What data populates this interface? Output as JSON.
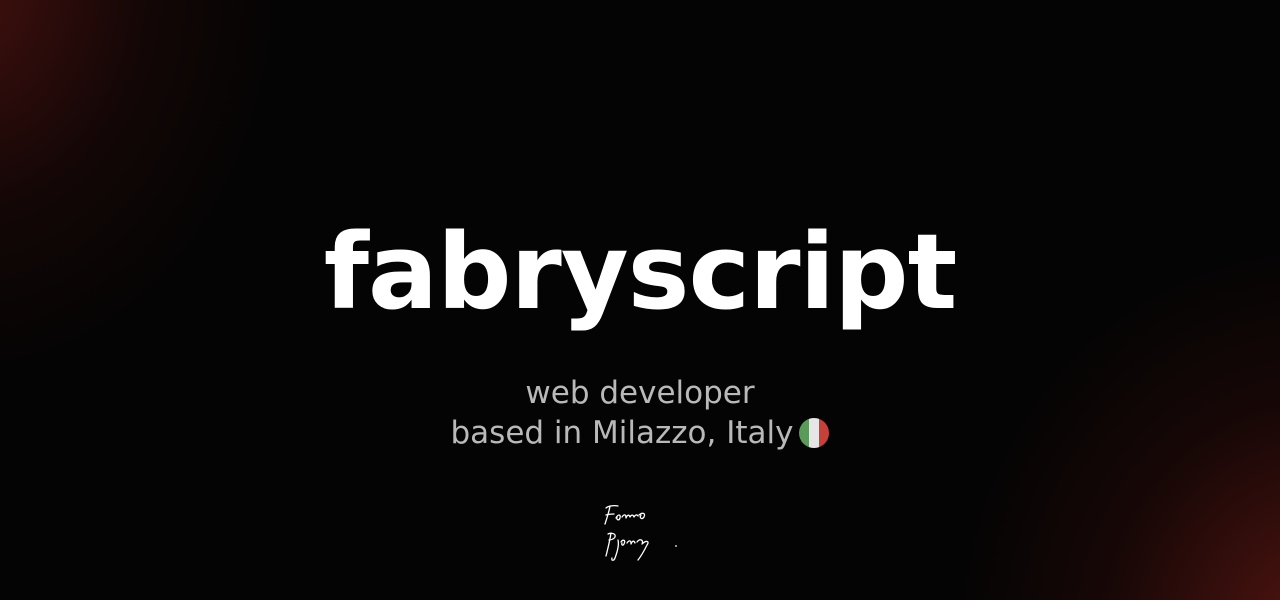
{
  "hero": {
    "title": "fabryscript",
    "tagline_line1": "web developer",
    "tagline_line2": "based in Milazzo, Italy"
  },
  "icons": {
    "flag": "italy-flag-icon",
    "signature": "handwritten-signature"
  },
  "colors": {
    "background": "#050404",
    "accent_glow": "#7d1e18",
    "title": "#ffffff",
    "tagline": "#b9b9b9",
    "flag_green": "#5a9a5a",
    "flag_white": "#e6e6e6",
    "flag_red": "#c8403a"
  }
}
